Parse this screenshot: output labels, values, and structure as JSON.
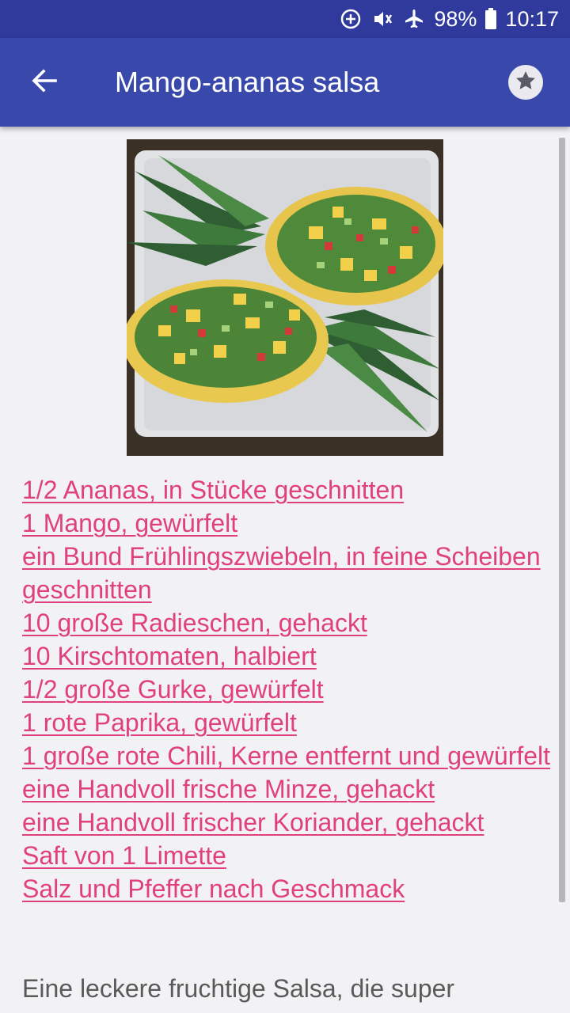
{
  "status_bar": {
    "battery": "98%",
    "time": "10:17",
    "icons": [
      "data-saver-icon",
      "mute-vibrate-icon",
      "airplane-icon",
      "battery-icon"
    ]
  },
  "app_bar": {
    "back_icon": "arrow-left-icon",
    "title": "Mango-ananas salsa",
    "favorite_icon": "star-icon"
  },
  "recipe": {
    "image_subject": "pineapple-boats-with-salsa",
    "ingredients": [
      "1/2 Ananas, in Stücke geschnitten",
      "1 Mango, gewürfelt",
      "ein Bund Frühlingszwiebeln, in feine Scheiben geschnitten",
      "10 große Radieschen, gehackt",
      "10 Kirschtomaten, halbiert",
      "1/2 große Gurke, gewürfelt",
      "1 rote Paprika, gewürfelt",
      "1 große rote Chili, Kerne entfernt und gewürfelt",
      "eine Handvoll frische Minze, gehackt",
      "eine Handvoll frischer Koriander, gehackt",
      "Saft von 1 Limette",
      "Salz und Pfeffer nach Geschmack"
    ],
    "description": "Eine leckere fruchtige Salsa, die super"
  },
  "colors": {
    "status_bar": "#2f3a9c",
    "app_bar": "#3949ab",
    "link": "#e0407e",
    "background": "#f2f1f4"
  }
}
